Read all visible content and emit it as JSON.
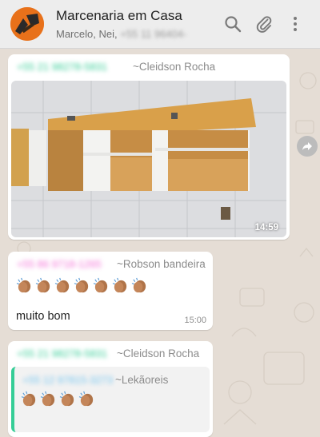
{
  "header": {
    "title": "Marcenaria em Casa",
    "subtitle_names": "Marcelo, Nei,",
    "subtitle_phone": "+55 11 96404-"
  },
  "messages": [
    {
      "sender_phone": "+55 21 98278-5831",
      "sender_name": "~Cleidson Rocha",
      "phone_color": "#35cd96",
      "time": "14:59"
    },
    {
      "sender_phone": "+55 86 9718-1265",
      "sender_name": "~Robson bandeira",
      "phone_color": "#f36fd6",
      "emoji": "clapping-hands x7",
      "text": "muito bom",
      "time": "15:00"
    },
    {
      "sender_phone": "+55 21 98278-5831",
      "sender_name": "~Cleidson Rocha",
      "phone_color": "#35cd96",
      "quote_phone": "+55 12 97815-3273",
      "quote_name": "~Lekãoreis",
      "quote_phone_color": "#75c6f0",
      "quote_emoji": "clapping-hands x4"
    }
  ],
  "icons": [
    "search-icon",
    "paperclip-icon",
    "menu-icon",
    "forward-icon"
  ]
}
